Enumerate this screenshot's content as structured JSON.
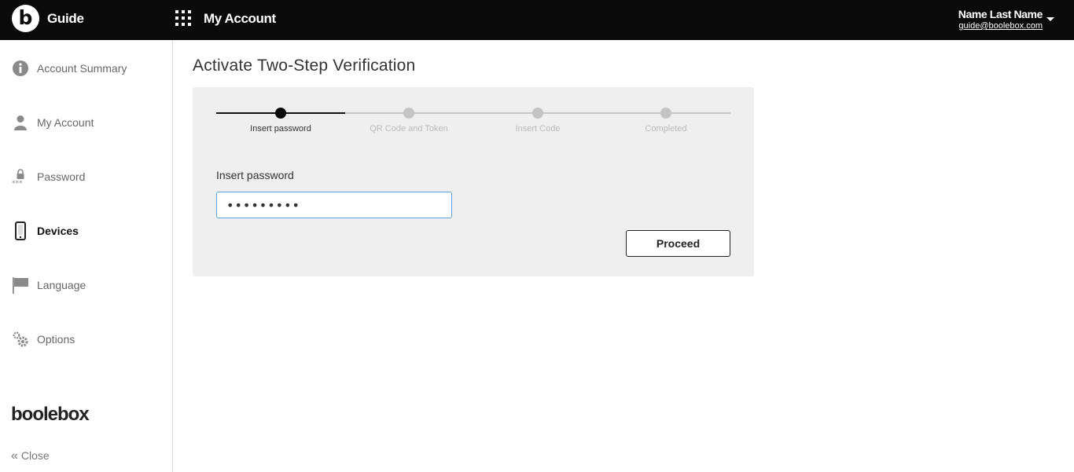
{
  "header": {
    "logo_letter": "b",
    "app_title": "Guide",
    "section_title": "My Account",
    "user_name": "Name Last Name",
    "user_email": "guide@boolebox.com"
  },
  "sidebar": {
    "items": [
      {
        "label": "Account Summary",
        "icon": "info-icon",
        "active": false
      },
      {
        "label": "My Account",
        "icon": "user-icon",
        "active": false
      },
      {
        "label": "Password",
        "icon": "lock-icon",
        "active": false
      },
      {
        "label": "Devices",
        "icon": "phone-icon",
        "active": true
      },
      {
        "label": "Language",
        "icon": "flag-icon",
        "active": false
      },
      {
        "label": "Options",
        "icon": "gears-icon",
        "active": false
      }
    ],
    "brand": "boolebox",
    "close_label": "Close"
  },
  "main": {
    "title": "Activate Two-Step Verification",
    "steps": [
      {
        "label": "Insert password",
        "active": true
      },
      {
        "label": "QR Code and Token",
        "active": false
      },
      {
        "label": "Insert Code",
        "active": false
      },
      {
        "label": "Completed",
        "active": false
      }
    ],
    "field_label": "Insert password",
    "password_value": "•••••••••",
    "proceed_label": "Proceed"
  },
  "colors": {
    "topbar": "#0a0a0a",
    "panel": "#efefef",
    "input_focus_border": "#5aa0e6"
  }
}
